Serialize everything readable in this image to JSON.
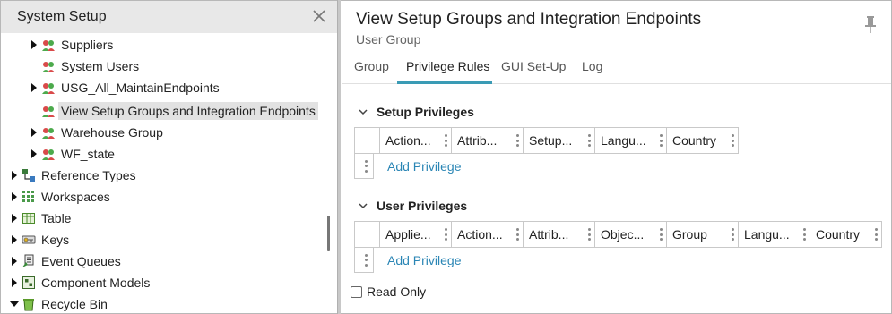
{
  "left_panel": {
    "title": "System Setup",
    "tree": [
      {
        "label": "Suppliers",
        "expandable": true,
        "icon": "user-group-icon"
      },
      {
        "label": "System Users",
        "expandable": false,
        "icon": "user-group-icon"
      },
      {
        "label": "USG_All_MaintainEndpoints",
        "expandable": true,
        "icon": "user-group-icon"
      },
      {
        "label": "View Setup Groups and Integration Endpoints",
        "expandable": false,
        "icon": "user-group-icon",
        "selected": true
      },
      {
        "label": "Warehouse Group",
        "expandable": true,
        "icon": "user-group-icon"
      },
      {
        "label": "WF_state",
        "expandable": true,
        "icon": "user-group-icon"
      },
      {
        "label": "Reference Types",
        "expandable": true,
        "icon": "reference-types-icon"
      },
      {
        "label": "Workspaces",
        "expandable": true,
        "icon": "workspaces-icon"
      },
      {
        "label": "Table",
        "expandable": true,
        "icon": "table-icon"
      },
      {
        "label": "Keys",
        "expandable": true,
        "icon": "keys-icon"
      },
      {
        "label": "Event Queues",
        "expandable": true,
        "icon": "event-queues-icon"
      },
      {
        "label": "Component Models",
        "expandable": true,
        "icon": "component-models-icon"
      },
      {
        "label": "Recycle Bin",
        "expandable": true,
        "expanded": true,
        "icon": "recycle-bin-icon"
      }
    ]
  },
  "header": {
    "title": "View Setup Groups and Integration Endpoints",
    "subtitle": "User Group"
  },
  "tabs": [
    {
      "label": "Group"
    },
    {
      "label": "Privilege Rules",
      "active": true
    },
    {
      "label": "GUI Set-Up"
    },
    {
      "label": "Log"
    }
  ],
  "setup_privileges": {
    "title": "Setup Privileges",
    "columns": [
      "Action...",
      "Attrib...",
      "Setup...",
      "Langu...",
      "Country"
    ],
    "add_label": "Add Privilege"
  },
  "user_privileges": {
    "title": "User Privileges",
    "columns": [
      "Applie...",
      "Action...",
      "Attrib...",
      "Objec...",
      "Group",
      "Langu...",
      "Country"
    ],
    "add_label": "Add Privilege"
  },
  "read_only": {
    "label": "Read Only",
    "checked": false
  },
  "colors": {
    "accent": "#3a9bb5",
    "link": "#2b86b5",
    "header_bg": "#e8e8e8"
  }
}
